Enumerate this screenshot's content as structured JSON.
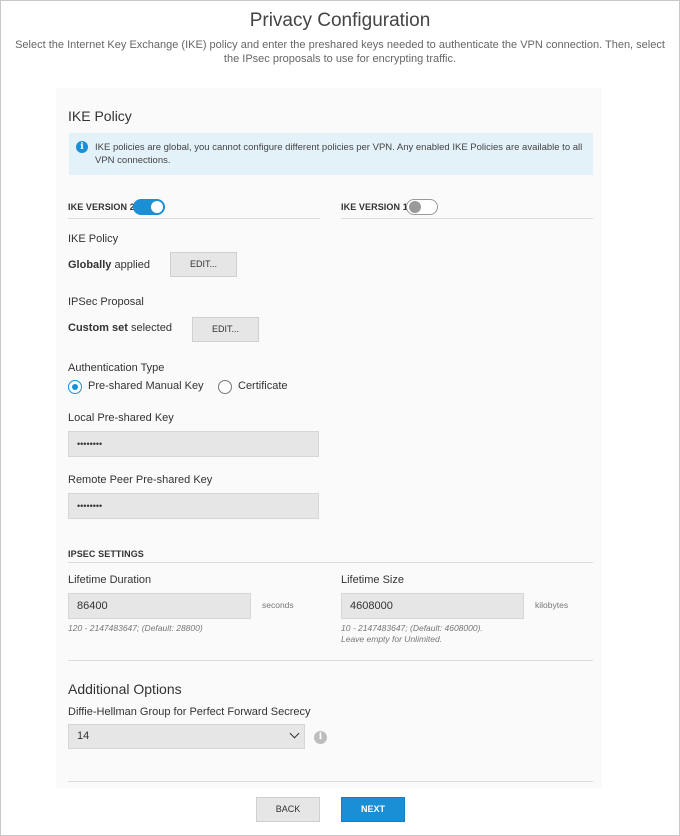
{
  "header": {
    "title": "Privacy Configuration",
    "subtitle": "Select the Internet Key Exchange (IKE) policy and enter the preshared keys needed to authenticate the VPN connection. Then, select the IPsec proposals to use for encrypting traffic."
  },
  "ike_policy": {
    "section_title": "IKE Policy",
    "info_text": "IKE policies are global, you cannot configure different policies per VPN. Any enabled IKE Policies are available to all VPN connections.",
    "ike_v2": {
      "label": "IKE VERSION 2",
      "enabled": true
    },
    "ike_v1": {
      "label": "IKE VERSION 1",
      "enabled": false
    },
    "policy_label": "IKE Policy",
    "policy_status_bold": "Globally",
    "policy_status_rest": " applied",
    "policy_edit_label": "EDIT...",
    "proposal_label": "IPSec Proposal",
    "proposal_status_bold": "Custom set",
    "proposal_status_rest": " selected",
    "proposal_edit_label": "EDIT..."
  },
  "auth": {
    "label": "Authentication Type",
    "options": [
      {
        "label": "Pre-shared Manual Key",
        "checked": true
      },
      {
        "label": "Certificate",
        "checked": false
      }
    ],
    "local_key_label": "Local Pre-shared Key",
    "local_key_value": "••••••••",
    "remote_key_label": "Remote Peer Pre-shared Key",
    "remote_key_value": "••••••••"
  },
  "ipsec": {
    "section_label": "IPSEC SETTINGS",
    "lifetime_duration_label": "Lifetime Duration",
    "lifetime_duration_value": "86400",
    "lifetime_duration_unit": "seconds",
    "lifetime_duration_hint": "120 - 2147483647; (Default: 28800)",
    "lifetime_size_label": "Lifetime Size",
    "lifetime_size_value": "4608000",
    "lifetime_size_unit": "kilobytes",
    "lifetime_size_hint_1": "10 - 2147483647; (Default: 4608000).",
    "lifetime_size_hint_2": "Leave empty for Unlimited."
  },
  "additional": {
    "section_title": "Additional Options",
    "dh_label": "Diffie-Hellman Group for Perfect Forward Secrecy",
    "dh_value": "14",
    "dh_icons": {
      "dropdown": "chevron-down-icon",
      "help": "info-icon"
    }
  },
  "footer": {
    "back_label": "BACK",
    "next_label": "NEXT"
  },
  "colors": {
    "accent": "#1b8fd6",
    "info_bg": "#e3f1f9",
    "field_bg": "#e6e6e6"
  }
}
